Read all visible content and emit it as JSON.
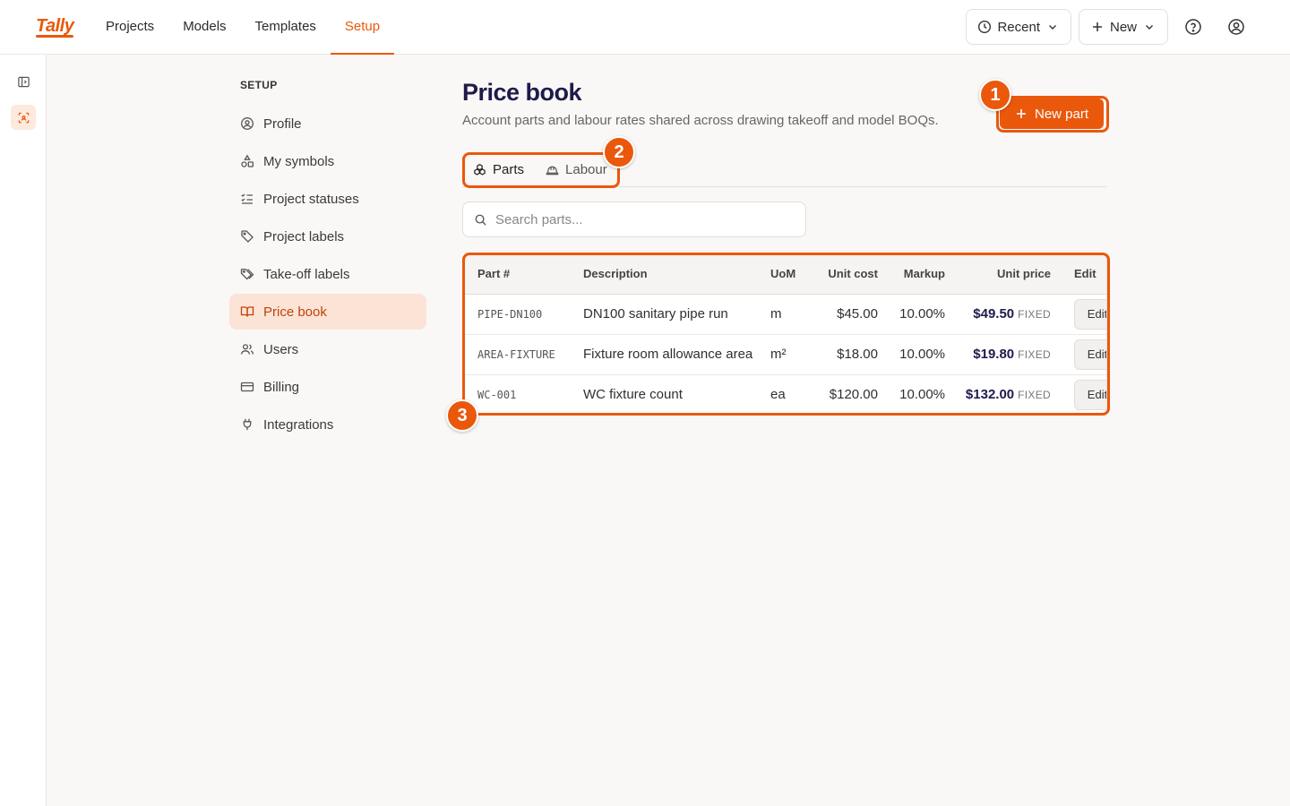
{
  "app": {
    "logo": "Tally"
  },
  "nav": {
    "items": [
      {
        "label": "Projects",
        "active": false
      },
      {
        "label": "Models",
        "active": false
      },
      {
        "label": "Templates",
        "active": false
      },
      {
        "label": "Setup",
        "active": true
      }
    ]
  },
  "topbar": {
    "recent_label": "Recent",
    "new_label": "New"
  },
  "setup": {
    "heading": "SETUP",
    "items": [
      {
        "label": "Profile",
        "icon": "user-circle-icon"
      },
      {
        "label": "My symbols",
        "icon": "shapes-icon"
      },
      {
        "label": "Project statuses",
        "icon": "checklist-icon"
      },
      {
        "label": "Project labels",
        "icon": "tag-icon"
      },
      {
        "label": "Take-off labels",
        "icon": "tags-icon"
      },
      {
        "label": "Price book",
        "icon": "book-open-icon",
        "active": true
      },
      {
        "label": "Users",
        "icon": "users-icon"
      },
      {
        "label": "Billing",
        "icon": "credit-card-icon"
      },
      {
        "label": "Integrations",
        "icon": "plug-icon"
      }
    ]
  },
  "page": {
    "title": "Price book",
    "subtitle": "Account parts and labour rates shared across drawing takeoff and model BOQs.",
    "new_part_label": "New part"
  },
  "tabs": [
    {
      "label": "Parts",
      "active": true
    },
    {
      "label": "Labour",
      "active": false
    }
  ],
  "search": {
    "placeholder": "Search parts..."
  },
  "table": {
    "columns": [
      "Part #",
      "Description",
      "UoM",
      "Unit cost",
      "Markup",
      "Unit price",
      "Edit"
    ],
    "rows": [
      {
        "part": "PIPE-DN100",
        "description": "DN100 sanitary pipe run",
        "uom": "m",
        "unit_cost": "$45.00",
        "markup": "10.00%",
        "unit_price": "$49.50",
        "price_type": "FIXED",
        "action": "Edit"
      },
      {
        "part": "AREA-FIXTURE",
        "description": "Fixture room allowance area",
        "uom": "m²",
        "unit_cost": "$18.00",
        "markup": "10.00%",
        "unit_price": "$19.80",
        "price_type": "FIXED",
        "action": "Edit"
      },
      {
        "part": "WC-001",
        "description": "WC fixture count",
        "uom": "ea",
        "unit_cost": "$120.00",
        "markup": "10.00%",
        "unit_price": "$132.00",
        "price_type": "FIXED",
        "action": "Edit"
      }
    ]
  },
  "annotations": [
    {
      "number": "1",
      "target": "New part button"
    },
    {
      "number": "2",
      "target": "Parts / Labour tabs"
    },
    {
      "number": "3",
      "target": "Parts table"
    }
  ],
  "colors": {
    "accent": "#ea580c",
    "title": "#1e1b4b",
    "active_bg": "#fbe4d6"
  }
}
